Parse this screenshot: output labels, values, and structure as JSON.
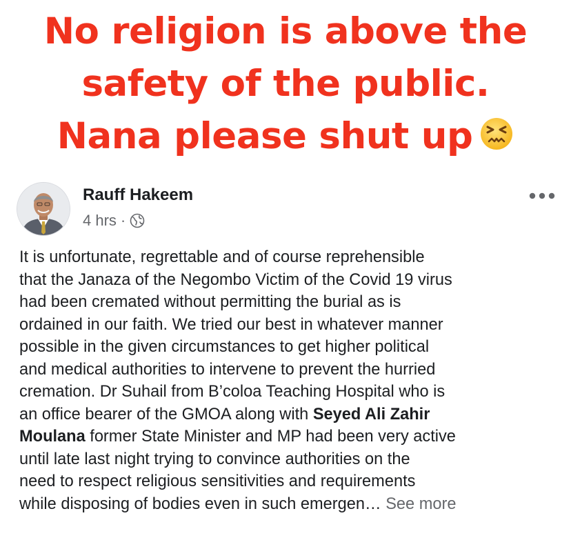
{
  "caption": {
    "line1": "No religion is above the",
    "line2": "safety of the public.",
    "line3": "Nana please shut up",
    "emoji": "confounded-face-emoji"
  },
  "colors": {
    "caption": "#f0321e",
    "text": "#1c1e21",
    "secondary": "#65676b"
  },
  "post": {
    "author": "Rauff Hakeem",
    "time": "4 hrs",
    "separator": "·",
    "privacy_icon": "globe-icon",
    "options_icon": "more-options-icon",
    "lines": [
      "It is unfortunate, regrettable and of course reprehensible",
      "that the Janaza of the Negombo Victim of the Covid 19 virus",
      "had been cremated without permitting the burial as is",
      "ordained in our faith. We tried our best in whatever manner",
      "possible  in the given circumstances to get higher political",
      "and medical authorities to intervene to prevent the hurried",
      "cremation. Dr Suhail from B’coloa Teaching Hospital who is"
    ],
    "line8_pre": "an office bearer of the GMOA along with ",
    "line8_bold": "Seyed Ali Zahir",
    "line9_bold": "Moulana",
    "line9_post": " former State Minister and MP had been very active",
    "lines_tail": [
      "until late last night trying to convince authorities on the",
      "need to respect religious sensitivities and requirements"
    ],
    "last_line": "while disposing of bodies even in such  emergen…",
    "see_more": "See more"
  }
}
